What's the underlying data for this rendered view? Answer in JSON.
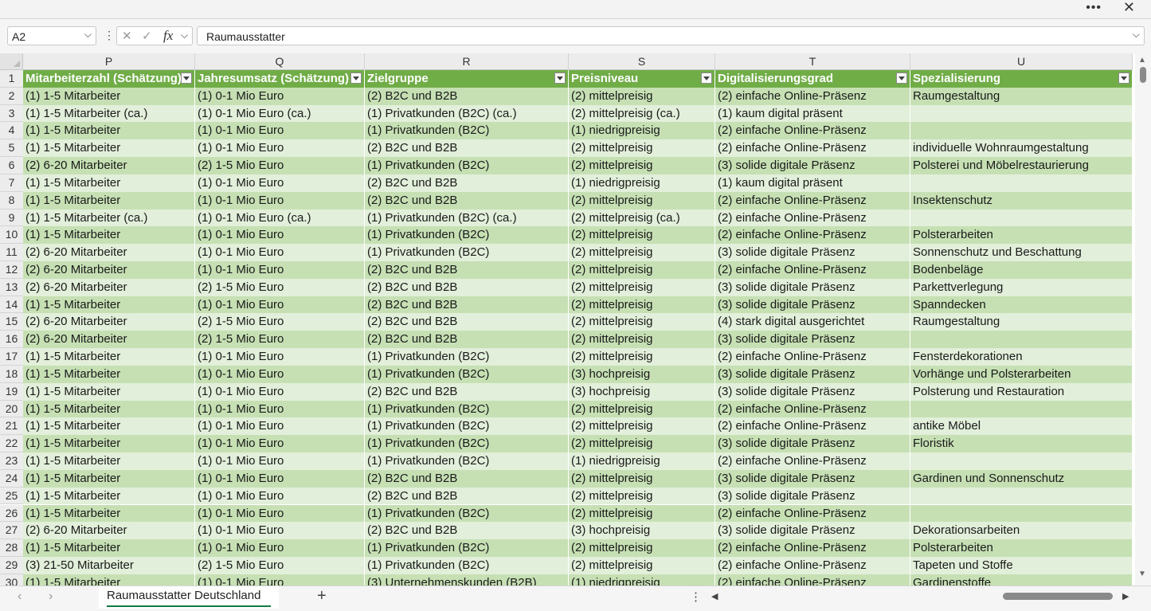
{
  "window": {
    "more_icon": "more-horizontal-icon",
    "close_icon": "close-icon"
  },
  "formula_bar": {
    "name_box": "A2",
    "formula": "Raumausstatter",
    "fx_label": "fx"
  },
  "columns": [
    {
      "letter": "P",
      "header": "Mitarbeiterzahl (Schätzung)"
    },
    {
      "letter": "Q",
      "header": "Jahresumsatz (Schätzung)"
    },
    {
      "letter": "R",
      "header": "Zielgruppe"
    },
    {
      "letter": "S",
      "header": "Preisniveau"
    },
    {
      "letter": "T",
      "header": "Digitalisierungsgrad"
    },
    {
      "letter": "U",
      "header": "Spezialisierung"
    }
  ],
  "header_row_number": "1",
  "rows": [
    {
      "num": "2",
      "cells": [
        "(1) 1-5 Mitarbeiter",
        "(1) 0-1 Mio Euro",
        "(2) B2C und B2B",
        "(2) mittelpreisig",
        "(2) einfache Online-Präsenz",
        "Raumgestaltung"
      ]
    },
    {
      "num": "3",
      "cells": [
        "(1) 1-5 Mitarbeiter (ca.)",
        "(1) 0-1 Mio Euro (ca.)",
        "(1) Privatkunden (B2C) (ca.)",
        "(2) mittelpreisig (ca.)",
        "(1) kaum digital präsent",
        ""
      ]
    },
    {
      "num": "4",
      "cells": [
        "(1) 1-5 Mitarbeiter",
        "(1) 0-1 Mio Euro",
        "(1) Privatkunden (B2C)",
        "(1) niedrigpreisig",
        "(2) einfache Online-Präsenz",
        ""
      ]
    },
    {
      "num": "5",
      "cells": [
        "(1) 1-5 Mitarbeiter",
        "(1) 0-1 Mio Euro",
        "(2) B2C und B2B",
        "(2) mittelpreisig",
        "(2) einfache Online-Präsenz",
        "individuelle Wohnraumgestaltung"
      ]
    },
    {
      "num": "6",
      "cells": [
        "(2) 6-20 Mitarbeiter",
        "(2) 1-5 Mio Euro",
        "(1) Privatkunden (B2C)",
        "(2) mittelpreisig",
        "(3) solide digitale Präsenz",
        "Polsterei und Möbelrestaurierung"
      ]
    },
    {
      "num": "7",
      "cells": [
        "(1) 1-5 Mitarbeiter",
        "(1) 0-1 Mio Euro",
        "(2) B2C und B2B",
        "(1) niedrigpreisig",
        "(1) kaum digital präsent",
        ""
      ]
    },
    {
      "num": "8",
      "cells": [
        "(1) 1-5 Mitarbeiter",
        "(1) 0-1 Mio Euro",
        "(2) B2C und B2B",
        "(2) mittelpreisig",
        "(2) einfache Online-Präsenz",
        "Insektenschutz"
      ]
    },
    {
      "num": "9",
      "cells": [
        "(1) 1-5 Mitarbeiter (ca.)",
        "(1) 0-1 Mio Euro (ca.)",
        "(1) Privatkunden (B2C) (ca.)",
        "(2) mittelpreisig (ca.)",
        "(2) einfache Online-Präsenz",
        ""
      ]
    },
    {
      "num": "10",
      "cells": [
        "(1) 1-5 Mitarbeiter",
        "(1) 0-1 Mio Euro",
        "(1) Privatkunden (B2C)",
        "(2) mittelpreisig",
        "(2) einfache Online-Präsenz",
        "Polsterarbeiten"
      ]
    },
    {
      "num": "11",
      "cells": [
        "(2) 6-20 Mitarbeiter",
        "(1) 0-1 Mio Euro",
        "(1) Privatkunden (B2C)",
        "(2) mittelpreisig",
        "(3) solide digitale Präsenz",
        "Sonnenschutz und Beschattung"
      ]
    },
    {
      "num": "12",
      "cells": [
        "(2) 6-20 Mitarbeiter",
        "(1) 0-1 Mio Euro",
        "(2) B2C und B2B",
        "(2) mittelpreisig",
        "(2) einfache Online-Präsenz",
        "Bodenbeläge"
      ]
    },
    {
      "num": "13",
      "cells": [
        "(2) 6-20 Mitarbeiter",
        "(2) 1-5 Mio Euro",
        "(2) B2C und B2B",
        "(2) mittelpreisig",
        "(3) solide digitale Präsenz",
        "Parkettverlegung"
      ]
    },
    {
      "num": "14",
      "cells": [
        "(1) 1-5 Mitarbeiter",
        "(1) 0-1 Mio Euro",
        "(2) B2C und B2B",
        "(2) mittelpreisig",
        "(3) solide digitale Präsenz",
        "Spanndecken"
      ]
    },
    {
      "num": "15",
      "cells": [
        "(2) 6-20 Mitarbeiter",
        "(2) 1-5 Mio Euro",
        "(2) B2C und B2B",
        "(2) mittelpreisig",
        "(4) stark digital ausgerichtet",
        "Raumgestaltung"
      ]
    },
    {
      "num": "16",
      "cells": [
        "(2) 6-20 Mitarbeiter",
        "(2) 1-5 Mio Euro",
        "(2) B2C und B2B",
        "(2) mittelpreisig",
        "(3) solide digitale Präsenz",
        ""
      ]
    },
    {
      "num": "17",
      "cells": [
        "(1) 1-5 Mitarbeiter",
        "(1) 0-1 Mio Euro",
        "(1) Privatkunden (B2C)",
        "(2) mittelpreisig",
        "(2) einfache Online-Präsenz",
        "Fensterdekorationen"
      ]
    },
    {
      "num": "18",
      "cells": [
        "(1) 1-5 Mitarbeiter",
        "(1) 0-1 Mio Euro",
        "(1) Privatkunden (B2C)",
        "(3) hochpreisig",
        "(3) solide digitale Präsenz",
        "Vorhänge und Polsterarbeiten"
      ]
    },
    {
      "num": "19",
      "cells": [
        "(1) 1-5 Mitarbeiter",
        "(1) 0-1 Mio Euro",
        "(2) B2C und B2B",
        "(3) hochpreisig",
        "(3) solide digitale Präsenz",
        "Polsterung und Restauration"
      ]
    },
    {
      "num": "20",
      "cells": [
        "(1) 1-5 Mitarbeiter",
        "(1) 0-1 Mio Euro",
        "(1) Privatkunden (B2C)",
        "(2) mittelpreisig",
        "(2) einfache Online-Präsenz",
        ""
      ]
    },
    {
      "num": "21",
      "cells": [
        "(1) 1-5 Mitarbeiter",
        "(1) 0-1 Mio Euro",
        "(1) Privatkunden (B2C)",
        "(2) mittelpreisig",
        "(2) einfache Online-Präsenz",
        "antike Möbel"
      ]
    },
    {
      "num": "22",
      "cells": [
        "(1) 1-5 Mitarbeiter",
        "(1) 0-1 Mio Euro",
        "(1) Privatkunden (B2C)",
        "(2) mittelpreisig",
        "(3) solide digitale Präsenz",
        "Floristik"
      ]
    },
    {
      "num": "23",
      "cells": [
        "(1) 1-5 Mitarbeiter",
        "(1) 0-1 Mio Euro",
        "(1) Privatkunden (B2C)",
        "(1) niedrigpreisig",
        "(2) einfache Online-Präsenz",
        ""
      ]
    },
    {
      "num": "24",
      "cells": [
        "(1) 1-5 Mitarbeiter",
        "(1) 0-1 Mio Euro",
        "(2) B2C und B2B",
        "(2) mittelpreisig",
        "(3) solide digitale Präsenz",
        "Gardinen und Sonnenschutz"
      ]
    },
    {
      "num": "25",
      "cells": [
        "(1) 1-5 Mitarbeiter",
        "(1) 0-1 Mio Euro",
        "(2) B2C und B2B",
        "(2) mittelpreisig",
        "(3) solide digitale Präsenz",
        ""
      ]
    },
    {
      "num": "26",
      "cells": [
        "(1) 1-5 Mitarbeiter",
        "(1) 0-1 Mio Euro",
        "(1) Privatkunden (B2C)",
        "(2) mittelpreisig",
        "(2) einfache Online-Präsenz",
        ""
      ]
    },
    {
      "num": "27",
      "cells": [
        "(2) 6-20 Mitarbeiter",
        "(1) 0-1 Mio Euro",
        "(2) B2C und B2B",
        "(3) hochpreisig",
        "(3) solide digitale Präsenz",
        "Dekorationsarbeiten"
      ]
    },
    {
      "num": "28",
      "cells": [
        "(1) 1-5 Mitarbeiter",
        "(1) 0-1 Mio Euro",
        "(1) Privatkunden (B2C)",
        "(2) mittelpreisig",
        "(2) einfache Online-Präsenz",
        "Polsterarbeiten"
      ]
    },
    {
      "num": "29",
      "cells": [
        "(3) 21-50 Mitarbeiter",
        "(2) 1-5 Mio Euro",
        "(1) Privatkunden (B2C)",
        "(2) mittelpreisig",
        "(2) einfache Online-Präsenz",
        "Tapeten und Stoffe"
      ]
    },
    {
      "num": "30",
      "cells": [
        "(1) 1-5 Mitarbeiter",
        "(1) 0-1 Mio Euro",
        "(3) Unternehmenskunden (B2B)",
        "(1) niedrigpreisig",
        "(2) einfache Online-Präsenz",
        "Gardinenstoffe"
      ]
    }
  ],
  "sheet_tabs": [
    {
      "label": "Raumausstatter Deutschland",
      "active": true
    }
  ],
  "colors": {
    "header_green": "#70ad47",
    "band_dark": "#c6e0b4",
    "band_light": "#e2efda",
    "active_tab_underline": "#107c41"
  }
}
